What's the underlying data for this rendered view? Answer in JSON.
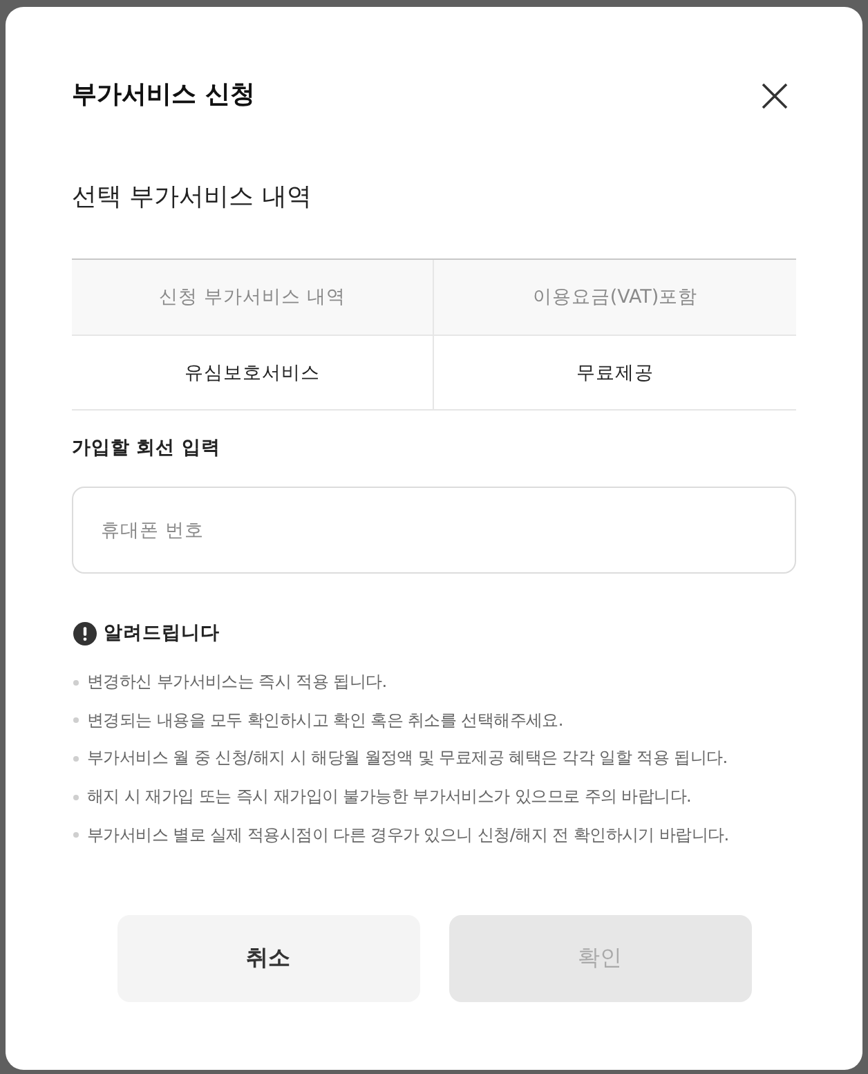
{
  "dialog": {
    "title": "부가서비스 신청"
  },
  "selected_services": {
    "title": "선택 부가서비스 내역",
    "columns": [
      "신청 부가서비스 내역",
      "이용요금(VAT)포함"
    ],
    "rows": [
      [
        "유심보호서비스",
        "무료제공"
      ]
    ]
  },
  "line_input": {
    "label": "가입할 회선 입력",
    "placeholder": "휴대폰 번호"
  },
  "notice": {
    "title": "알려드립니다",
    "items": [
      "변경하신 부가서비스는 즉시 적용 됩니다.",
      "변경되는 내용을 모두 확인하시고 확인 혹은 취소를 선택해주세요.",
      "부가서비스 월 중 신청/해지 시 해당월 월정액 및 무료제공 혜택은 각각 일할 적용 됩니다.",
      "해지 시 재가입 또는 즉시 재가입이 불가능한 부가서비스가 있으므로 주의 바랍니다.",
      "부가서비스 별로 실제 적용시점이 다른 경우가 있으니 신청/해지 전 확인하시기 바랍니다."
    ]
  },
  "buttons": [
    {
      "label": "취소",
      "disabled": false
    },
    {
      "label": "확인",
      "disabled": true
    }
  ]
}
